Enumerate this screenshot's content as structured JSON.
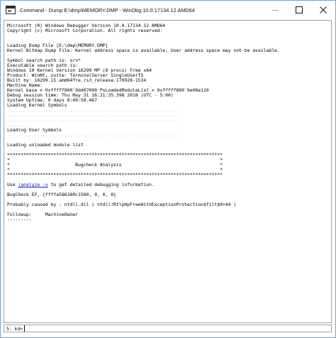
{
  "window": {
    "title": "Command - Dump E:\\dmp\\MEMORY.DMP - WinDbg:10.0.17134.12 AMD64"
  },
  "output_lines": [
    {
      "kind": "text",
      "text": "Microsoft (R) Windows Debugger Version 10.0.17134.12 AMD64"
    },
    {
      "kind": "text",
      "text": "Copyright (c) Microsoft Corporation. All rights reserved."
    },
    {
      "kind": "gap",
      "text": ""
    },
    {
      "kind": "gap",
      "text": ""
    },
    {
      "kind": "text",
      "text": "Loading Dump File [E:\\dmp\\MEMORY.DMP]"
    },
    {
      "kind": "text",
      "text": "Kernel Bitmap Dump File: Kernel address space is available, User address space may not be available."
    },
    {
      "kind": "gap",
      "text": ""
    },
    {
      "kind": "text",
      "text": "Symbol search path is: srv*"
    },
    {
      "kind": "text",
      "text": "Executable search path is:"
    },
    {
      "kind": "text",
      "text": "Windows 10 Kernel Version 16299 MP (8 procs) Free x64"
    },
    {
      "kind": "text",
      "text": "Product: WinNt, suite: TerminalServer SingleUserTS"
    },
    {
      "kind": "text",
      "text": "Built by: 16299.15.amd64fre.rs3_release.170928-1534"
    },
    {
      "kind": "text",
      "text": "Machine Name:"
    },
    {
      "kind": "text",
      "text": "Kernel base = 0xfffff800`9dd07000 PsLoadedModuleList = 0xfffff800`9e06e110"
    },
    {
      "kind": "text",
      "text": "Debug session time: Thu May 31 16:21:35.398 2018 (UTC - 5:00)"
    },
    {
      "kind": "text",
      "text": "System Uptime: 0 days 0:49:58.467"
    },
    {
      "kind": "text",
      "text": "Loading Kernel Symbols"
    },
    {
      "kind": "dots",
      "text": "..............................................................."
    },
    {
      "kind": "dots",
      "text": "..............................................................."
    },
    {
      "kind": "dots",
      "text": "..............................................................."
    },
    {
      "kind": "dots",
      "text": "........"
    },
    {
      "kind": "text",
      "text": "Loading User Symbols"
    },
    {
      "kind": "dots",
      "text": "..............................................................."
    },
    {
      "kind": "gap",
      "text": ""
    },
    {
      "kind": "text",
      "text": "Loading unloaded module list"
    },
    {
      "kind": "dots",
      "text": "........"
    },
    {
      "kind": "text",
      "text": "*******************************************************************************"
    },
    {
      "kind": "text",
      "text": "*                                                                             *"
    },
    {
      "kind": "text",
      "text": "*                        Bugcheck Analysis                                    *"
    },
    {
      "kind": "text",
      "text": "*                                                                             *"
    },
    {
      "kind": "text",
      "text": "*******************************************************************************"
    },
    {
      "kind": "gap",
      "text": ""
    },
    {
      "kind": "link",
      "pre": "Use ",
      "link": "!analyze -v",
      "post": " to get detailed debugging information."
    },
    {
      "kind": "gap",
      "text": ""
    },
    {
      "kind": "text",
      "text": "BugCheck EF, {ffffa586380c1580, 0, 0, 0}"
    },
    {
      "kind": "gap",
      "text": ""
    },
    {
      "kind": "text",
      "text": "Probably caused by : ntdll.dll ( ntdll!RtlpHpFreeWithExceptionProtection$filt$0+44 )"
    },
    {
      "kind": "gap",
      "text": ""
    },
    {
      "kind": "text",
      "text": "Followup:     MachineOwner"
    },
    {
      "kind": "text",
      "text": "---------"
    }
  ],
  "command_bar": {
    "prompt": "5: kd>",
    "value": ""
  },
  "icons": {
    "app": "console-app-icon",
    "minimize": "minimize-icon",
    "maximize": "maximize-icon",
    "close": "close-icon"
  }
}
